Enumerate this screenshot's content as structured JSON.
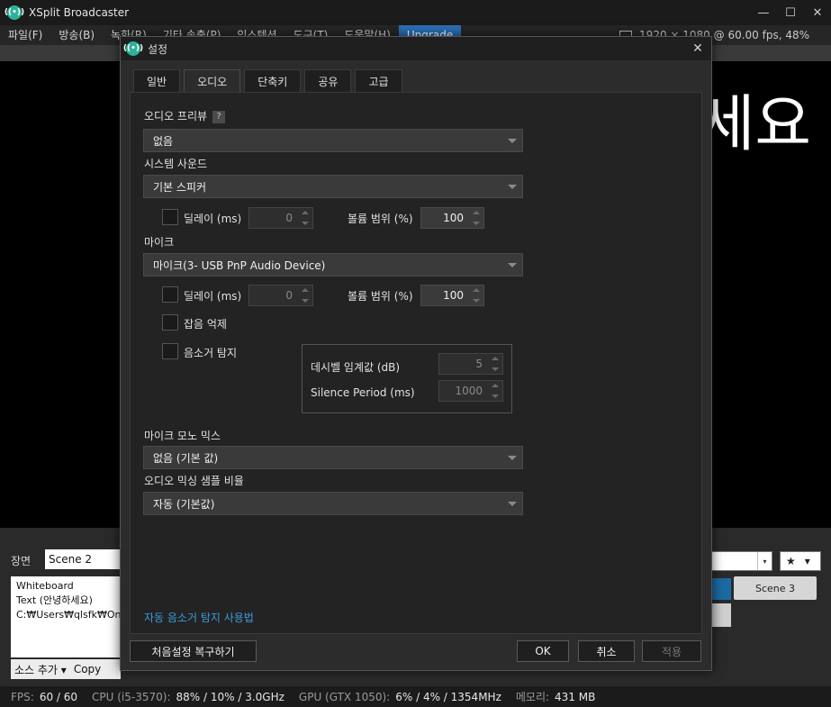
{
  "app": {
    "title": "XSplit Broadcaster",
    "window_controls": {
      "minimize": "—",
      "maximize": "☐",
      "close": "✕"
    },
    "menu": [
      "파일(F)",
      "방송(B)",
      "녹화(R)",
      "기타 송출(P)",
      "익스텐션",
      "도구(T)",
      "도움말(H)"
    ],
    "upgrade_label": "Upgrade",
    "resolution_text": "1920 × 1080 @ 60.00 fps, 48%",
    "preview_text": "세요"
  },
  "bottom": {
    "scene_label": "장면",
    "scene_name": "Scene 2",
    "sources": [
      "Whiteboard",
      "Text (안녕하세요)",
      "C:₩Users₩qlsfk₩One"
    ],
    "add_source": "소스 추가 ▾",
    "copy": "Copy",
    "scene3": "Scene 3",
    "star": "★",
    "dropdown_caret": "▾"
  },
  "status": {
    "fps_label": "FPS:",
    "fps_value": "60 / 60",
    "cpu_label": "CPU (i5-3570):",
    "cpu_value": "88% / 10% / 3.0GHz",
    "gpu_label": "GPU (GTX 1050):",
    "gpu_value": "6% / 4% / 1354MHz",
    "mem_label": "메모리:",
    "mem_value": "431 MB"
  },
  "dialog": {
    "title": "설정",
    "close": "✕",
    "tabs": [
      "일반",
      "오디오",
      "단축키",
      "공유",
      "고급"
    ],
    "active_tab": "오디오",
    "audio_preview_label": "오디오 프리뷰",
    "audio_preview_value": "없음",
    "help_icon": "?",
    "system_sound_label": "시스템 사운드",
    "system_sound_value": "기본 스피커",
    "delay_label": "딜레이 (ms)",
    "delay_value": "0",
    "volume_label": "볼륨 범위 (%)",
    "volume_value": "100",
    "mic_label": "마이크",
    "mic_value": "마이크(3- USB PnP Audio Device)",
    "mic_delay_value": "0",
    "mic_volume_value": "100",
    "noise_suppression": "잡음 억제",
    "voice_activity": "음소거 탐지",
    "decibel_label": "데시벨 임계값 (dB)",
    "decibel_value": "5",
    "silence_label": "Silence Period (ms)",
    "silence_value": "1000",
    "mono_mix_label": "마이크 모노 믹스",
    "mono_mix_value": "없음 (기본 값)",
    "sample_rate_label": "오디오 믹싱 샘플 비율",
    "sample_rate_value": "자동 (기본값)",
    "help_link": "자동 음소거 탐지 사용법",
    "reset_button": "처음설정 복구하기",
    "ok_button": "OK",
    "cancel_button": "취소",
    "apply_button": "적용"
  }
}
